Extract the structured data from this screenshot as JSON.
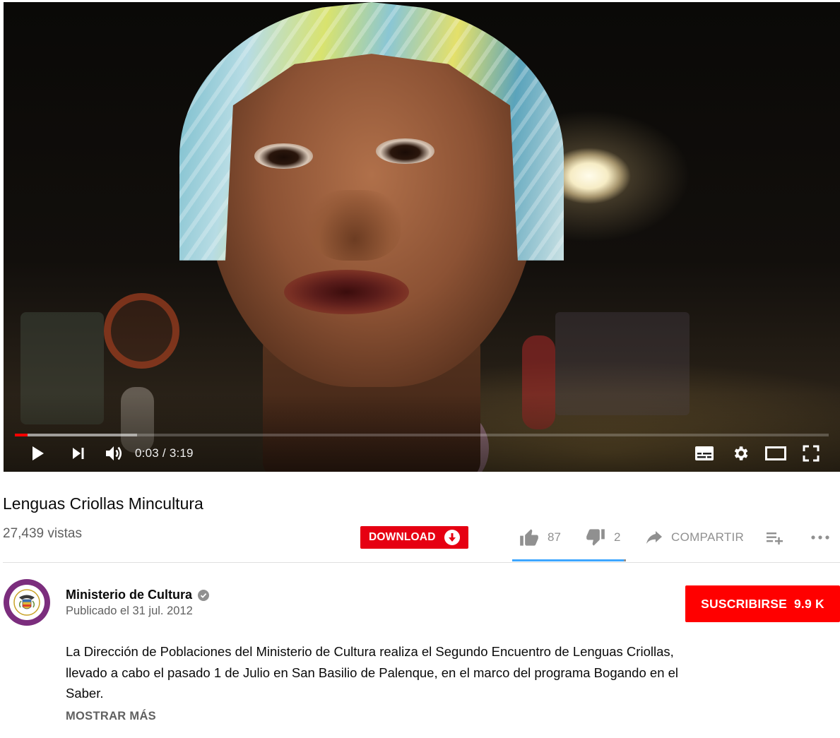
{
  "player": {
    "current_time": "0:03",
    "separator": "/",
    "duration": "3:19",
    "played_fraction": 0.016,
    "buffered_fraction": 0.15,
    "controls": [
      "play-icon",
      "next-icon",
      "volume-icon",
      "subtitles-icon",
      "settings-icon",
      "theater-mode-icon",
      "fullscreen-icon"
    ]
  },
  "video": {
    "title": "Lenguas Criollas Mincultura",
    "views": "27,439 vistas"
  },
  "actions": {
    "download_label": "DOWNLOAD",
    "likes": "87",
    "dislikes": "2",
    "share_label": "COMPARTIR",
    "like_ratio": 0.98
  },
  "channel": {
    "name": "Ministerio de Cultura",
    "published": "Publicado el 31 jul. 2012",
    "subscribe_label": "SUSCRIBIRSE",
    "subscriber_count": "9.9 K"
  },
  "description": {
    "text": "La Dirección de Poblaciones del Ministerio de Cultura realiza el Segundo Encuentro de Lenguas Criollas, llevado a cabo el pasado 1 de Julio en San Basilio de Palenque, en el marco del programa Bogando en el Saber.",
    "show_more": "MOSTRAR MÁS"
  },
  "colors": {
    "accent_red": "#ff0000",
    "download_red": "#e60012",
    "like_bar_blue": "#3ea6ff",
    "channel_purple": "#7b2d7d"
  }
}
